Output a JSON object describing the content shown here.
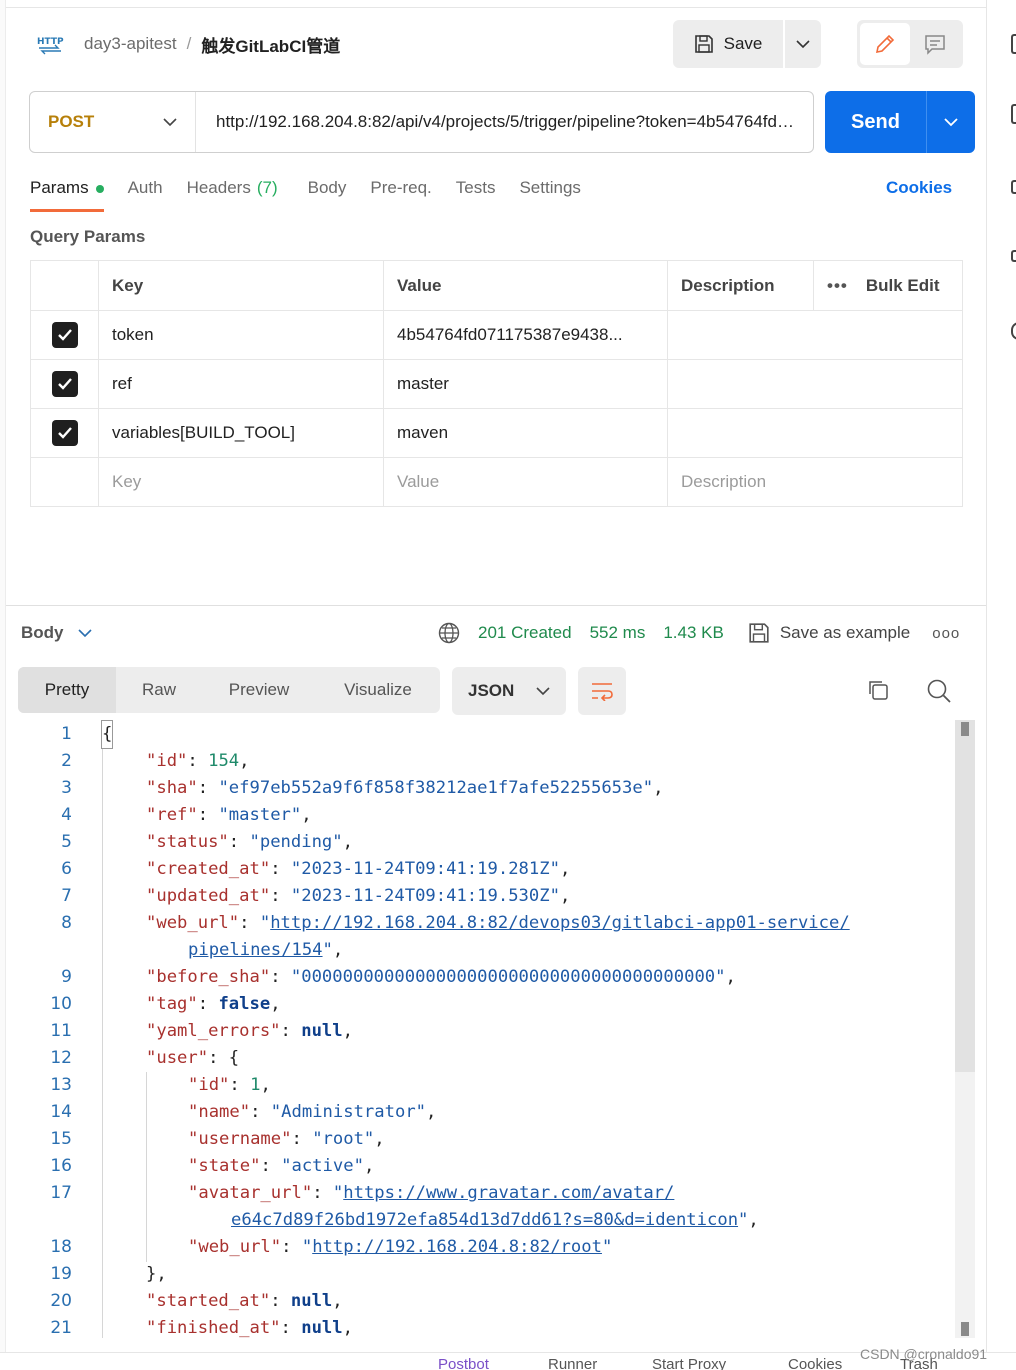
{
  "header": {
    "collection": "day3-apitest",
    "separator": "/",
    "request_name": "触发GitLabCI管道",
    "http_badge": "HTTP",
    "save_label": "Save"
  },
  "request": {
    "method": "POST",
    "url": "http://192.168.204.8:82/api/v4/projects/5/trigger/pipeline?token=4b54764fd071175387e9438...",
    "send_label": "Send"
  },
  "tabs": [
    {
      "label": "Params",
      "dot": true
    },
    {
      "label": "Auth"
    },
    {
      "label": "Headers",
      "count": "(7)"
    },
    {
      "label": "Body"
    },
    {
      "label": "Pre-req."
    },
    {
      "label": "Tests"
    },
    {
      "label": "Settings"
    }
  ],
  "cookies_label": "Cookies",
  "query_params": {
    "title": "Query Params",
    "columns": {
      "key": "Key",
      "value": "Value",
      "description": "Description",
      "bulk_edit": "Bulk Edit"
    },
    "rows": [
      {
        "key": "token",
        "value": "4b54764fd071175387e9438...",
        "description": ""
      },
      {
        "key": "ref",
        "value": "master",
        "description": ""
      },
      {
        "key": "variables[BUILD_TOOL]",
        "value": "maven",
        "description": ""
      }
    ],
    "placeholder": {
      "key": "Key",
      "value": "Value",
      "description": "Description"
    }
  },
  "response": {
    "section_label": "Body",
    "status": "201 Created",
    "time": "552 ms",
    "size": "1.43 KB",
    "save_example_label": "Save as example",
    "view_tabs": [
      "Pretty",
      "Raw",
      "Preview",
      "Visualize"
    ],
    "format": "JSON",
    "colors": {
      "status": "#1f8a4c"
    }
  },
  "code_lines": [
    "{",
    "\"id\": 154,",
    "\"sha\": \"ef97eb552a9f6f858f38212ae1f7afe52255653e\",",
    "\"ref\": \"master\",",
    "\"status\": \"pending\",",
    "\"created_at\": \"2023-11-24T09:41:19.281Z\",",
    "\"updated_at\": \"2023-11-24T09:41:19.530Z\",",
    "\"web_url\": \"http://192.168.204.8:82/devops03/gitlabci-app01-service/pipelines/154\",",
    "\"before_sha\": \"0000000000000000000000000000000000000000\",",
    "\"tag\": false,",
    "\"yaml_errors\": null,",
    "\"user\": {",
    "\"id\": 1,",
    "\"name\": \"Administrator\",",
    "\"username\": \"root\",",
    "\"state\": \"active\",",
    "\"avatar_url\": \"https://www.gravatar.com/avatar/e64c7d89f26bd1972efa854d13d7dd61?s=80&d=identicon\",",
    "\"web_url\": \"http://192.168.204.8:82/root\"",
    "},",
    "\"started_at\": null,",
    "\"finished_at\": null,"
  ],
  "status_bar": [
    "Postbot",
    "Runner",
    "Start Proxy",
    "Cookies",
    "Trash"
  ],
  "watermark": "CSDN @cronaldo91",
  "colors": {
    "accent": "#0d6ee8",
    "method": "#b7800a",
    "active_tab": "#f26b3a"
  }
}
